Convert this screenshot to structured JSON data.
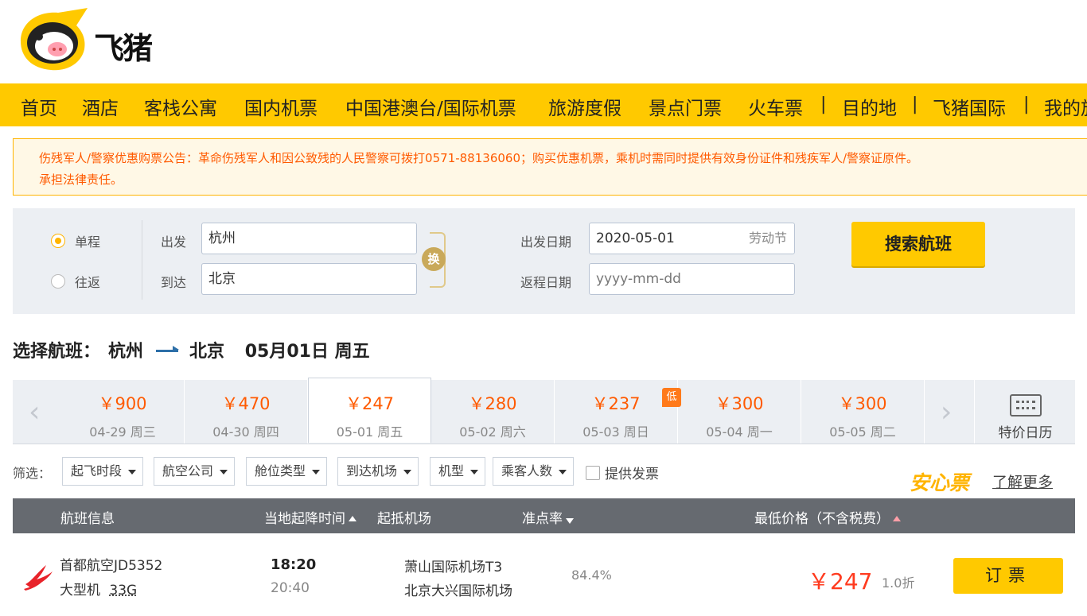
{
  "brand": {
    "name": "飞猪",
    "color": "#ffc900"
  },
  "nav": {
    "items": [
      "首页",
      "酒店",
      "客栈公寓",
      "国内机票",
      "中国港澳台/国际机票",
      "旅游度假",
      "景点门票",
      "火车票",
      "目的地",
      "飞猪国际",
      "我的旅行"
    ],
    "separator": "|"
  },
  "notice": {
    "line1": "伤残军人/警察优惠购票公告：革命伤残军人和因公致残的人民警察可拨打0571-88136060；购买优惠机票，乘机时需同时提供有效身份证件和残疾军人/警察证原件。",
    "line2": "承担法律责任。"
  },
  "search": {
    "trip_types": [
      "单程",
      "往返"
    ],
    "selected_trip_type": "单程",
    "from_label": "出发",
    "from_value": "杭州",
    "to_label": "到达",
    "to_value": "北京",
    "swap_label": "换",
    "depart_label": "出发日期",
    "depart_value": "2020-05-01",
    "depart_holiday": "劳动节",
    "return_label": "返程日期",
    "return_placeholder": "yyyy-mm-dd",
    "button": "搜索航班"
  },
  "route": {
    "prefix": "选择航班：",
    "from": "杭州",
    "to": "北京",
    "date": "05月01日 周五"
  },
  "date_prices": [
    {
      "price": "￥900",
      "date": "04-29 周三",
      "low": false
    },
    {
      "price": "￥470",
      "date": "04-30 周四",
      "low": false
    },
    {
      "price": "￥247",
      "date": "05-01 周五",
      "low": false,
      "active": true
    },
    {
      "price": "￥280",
      "date": "05-02 周六",
      "low": false
    },
    {
      "price": "￥237",
      "date": "05-03 周日",
      "low": true
    },
    {
      "price": "￥300",
      "date": "05-04 周一",
      "low": false
    },
    {
      "price": "￥300",
      "date": "05-05 周二",
      "low": false
    }
  ],
  "low_badge": "低",
  "calendar_label": "特价日历",
  "filters": {
    "label": "筛选：",
    "buttons": [
      "起飞时段",
      "航空公司",
      "舱位类型",
      "到达机场",
      "机型",
      "乘客人数"
    ],
    "checkbox_label": "提供发票",
    "anxin": "安心票",
    "learn_more": "了解更多"
  },
  "table": {
    "headers": {
      "info": "航班信息",
      "time": "当地起降时间",
      "airports": "起抵机场",
      "ontime": "准点率",
      "price": "最低价格（不含税费）"
    },
    "rows": [
      {
        "airline_flight": "首都航空JD5352",
        "aircraft": "大型机",
        "model": "33G",
        "dep_time": "18:20",
        "arr_time": "20:40",
        "dep_airport": "萧山国际机场T3",
        "arr_airport": "北京大兴国际机场",
        "ontime": "84.4%",
        "price": "￥247",
        "discount": "1.0折",
        "book": "订票"
      }
    ]
  },
  "colors": {
    "price": "#ff5a00",
    "accent": "#ffc900",
    "header_bg": "#666a70"
  }
}
